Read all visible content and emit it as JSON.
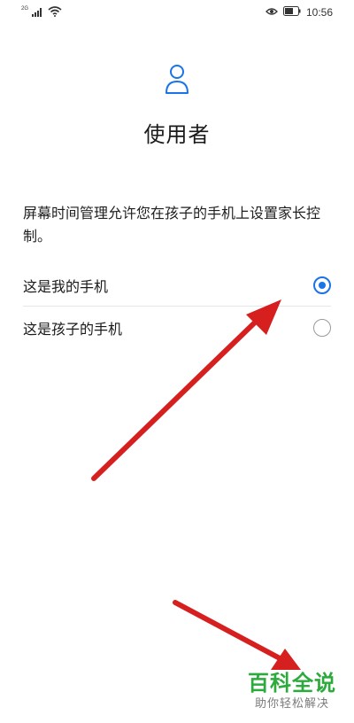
{
  "status_bar": {
    "network_type": "2G",
    "time": "10:56",
    "icons": [
      "signal-icon",
      "wifi-icon",
      "eye-icon",
      "battery-icon"
    ]
  },
  "header": {
    "icon": "user-icon",
    "title": "使用者"
  },
  "description": "屏幕时间管理允许您在孩子的手机上设置家长控制。",
  "options": [
    {
      "label": "这是我的手机",
      "selected": true
    },
    {
      "label": "这是孩子的手机",
      "selected": false
    }
  ],
  "watermark": {
    "title": "百科全说",
    "subtitle": "助你轻松解决"
  },
  "colors": {
    "accent": "#1a73e8",
    "annotation_arrow": "#d62020",
    "watermark_green": "#2daa3c"
  }
}
